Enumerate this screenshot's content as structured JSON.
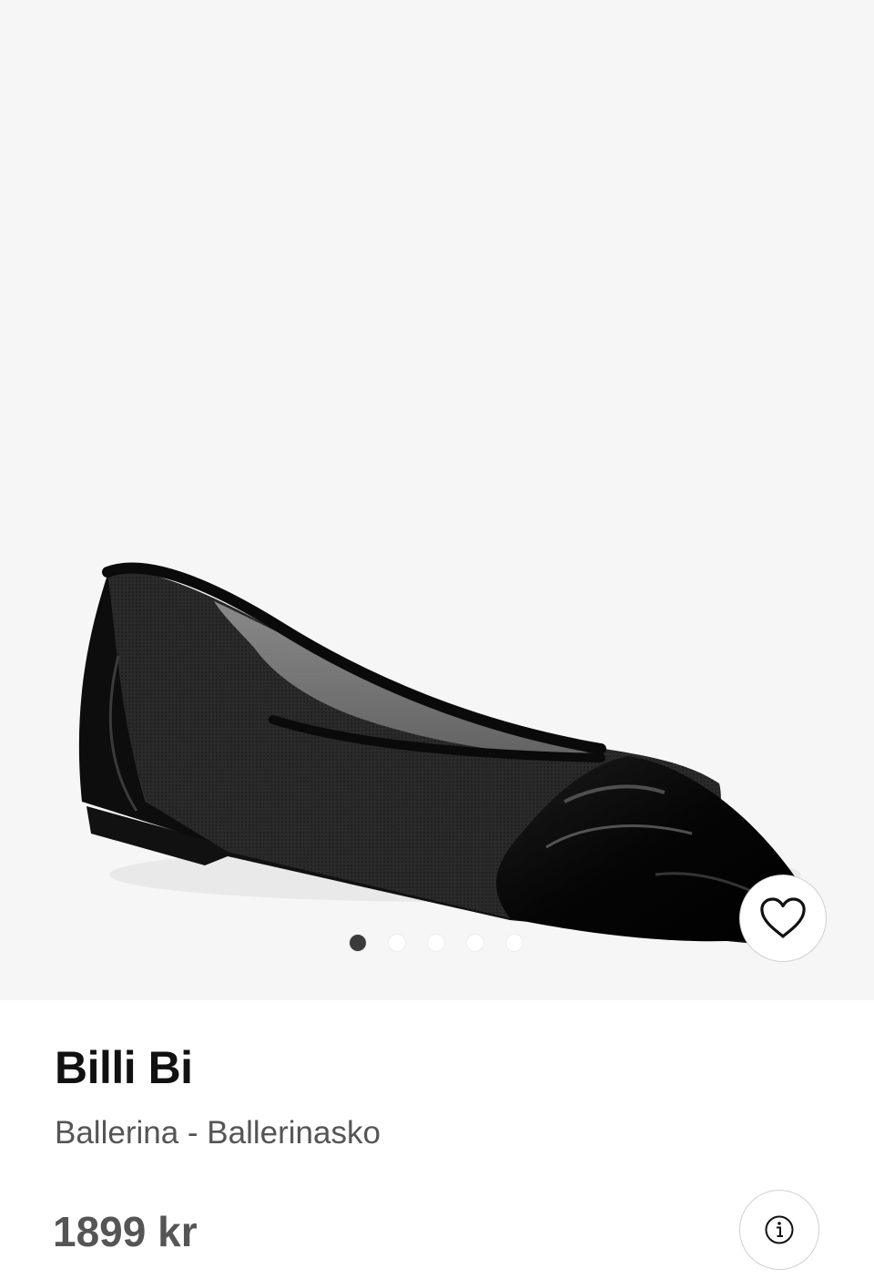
{
  "product": {
    "brand": "Billi Bi",
    "name": "Ballerina - Ballerinasko",
    "price": "1899 kr"
  },
  "gallery": {
    "image_count": 5,
    "active_index": 0
  },
  "icons": {
    "wishlist": "heart-icon",
    "info": "info-icon"
  },
  "colors": {
    "gallery_background": "#f6f6f6",
    "active_dot": "#3b3b3b",
    "text_primary": "#111111",
    "text_secondary": "#555555"
  }
}
